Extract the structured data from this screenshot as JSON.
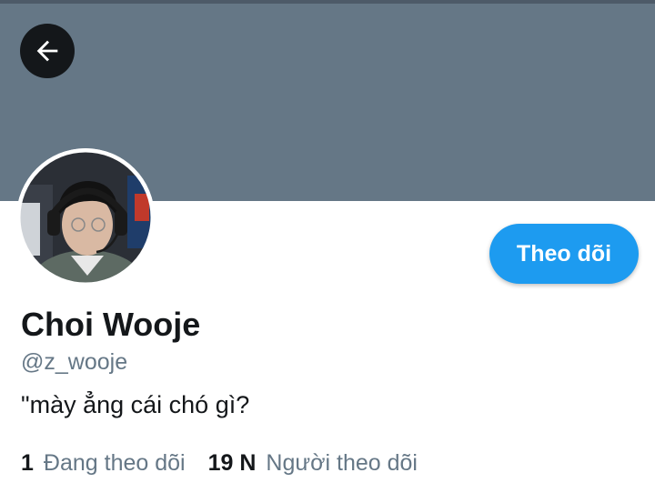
{
  "profile": {
    "display_name": "Choi Wooje",
    "handle": "@z_wooje",
    "bio": "\"mày ẳng cái chó gì?"
  },
  "actions": {
    "follow_label": "Theo dõi"
  },
  "stats": {
    "following_count": "1",
    "following_label": "Đang theo dõi",
    "followers_count": "19 N",
    "followers_label": "Người theo dõi"
  },
  "icons": {
    "back": "arrow-left-icon"
  },
  "colors": {
    "banner": "#657786",
    "accent": "#1d9bf0",
    "text_primary": "#14171a",
    "text_secondary": "#657786"
  }
}
